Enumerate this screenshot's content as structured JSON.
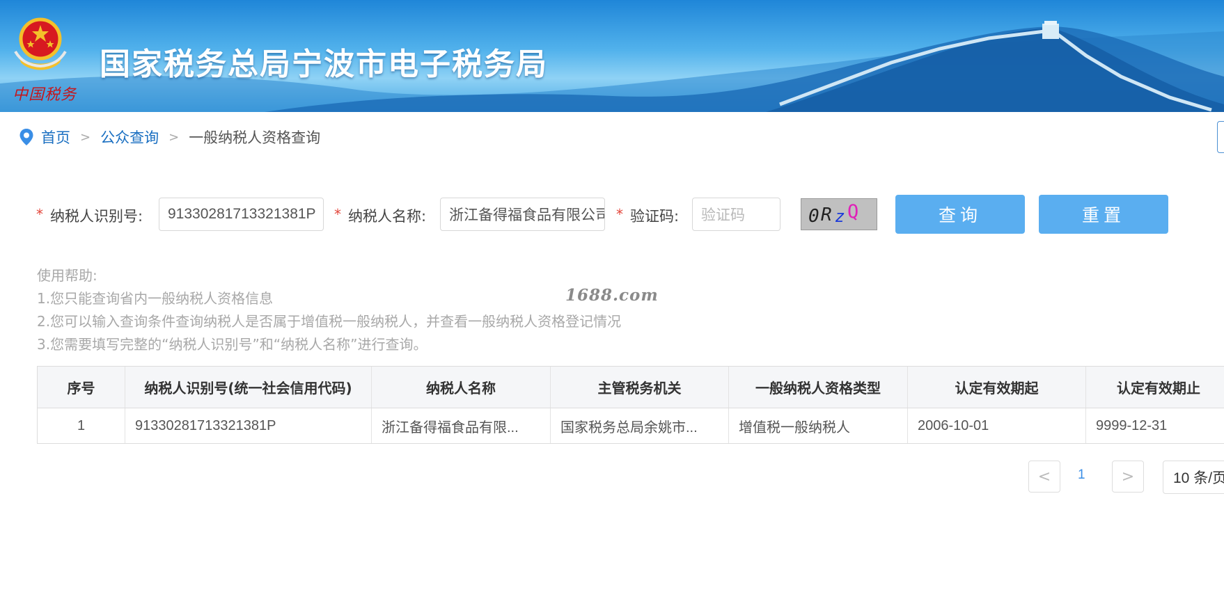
{
  "banner": {
    "title": "国家税务总局宁波市电子税务局",
    "seal_text": "中国税务"
  },
  "breadcrumb": {
    "home": "首页",
    "public_query": "公众查询",
    "current": "一般纳税人资格查询",
    "separator": ">"
  },
  "form": {
    "required_mark": "*",
    "taxpayer_id_label": "纳税人识别号:",
    "taxpayer_id_value": "91330281713321381P",
    "taxpayer_name_label": "纳税人名称:",
    "taxpayer_name_value": "浙江备得福食品有限公司",
    "captcha_label": "验证码:",
    "captcha_placeholder": "验证码",
    "captcha_text": [
      "0",
      "R",
      "z",
      "Q"
    ],
    "query_button": "查询",
    "reset_button": "重置"
  },
  "help": {
    "title": "使用帮助:",
    "line1": "1.您只能查询省内一般纳税人资格信息",
    "line2": "2.您可以输入查询条件查询纳税人是否属于增值税一般纳税人，并查看一般纳税人资格登记情况",
    "line3": "3.您需要填写完整的“纳税人识别号”和“纳税人名称”进行查询。",
    "watermark": "1688.com"
  },
  "table": {
    "headers": [
      "序号",
      "纳税人识别号(统一社会信用代码)",
      "纳税人名称",
      "主管税务机关",
      "一般纳税人资格类型",
      "认定有效期起",
      "认定有效期止"
    ],
    "rows": [
      [
        "1",
        "91330281713321381P",
        "浙江备得福食品有限...",
        "国家税务总局余姚市...",
        "增值税一般纳税人",
        "2006-10-01",
        "9999-12-31"
      ]
    ]
  },
  "pager": {
    "prev": "<",
    "next": ">",
    "current_page": "1",
    "page_size": "10 条/页"
  },
  "colors": {
    "primary_button": "#5aaef0",
    "link": "#1a6fc1",
    "required": "#e3463b",
    "page_active": "#3a8ee6"
  }
}
